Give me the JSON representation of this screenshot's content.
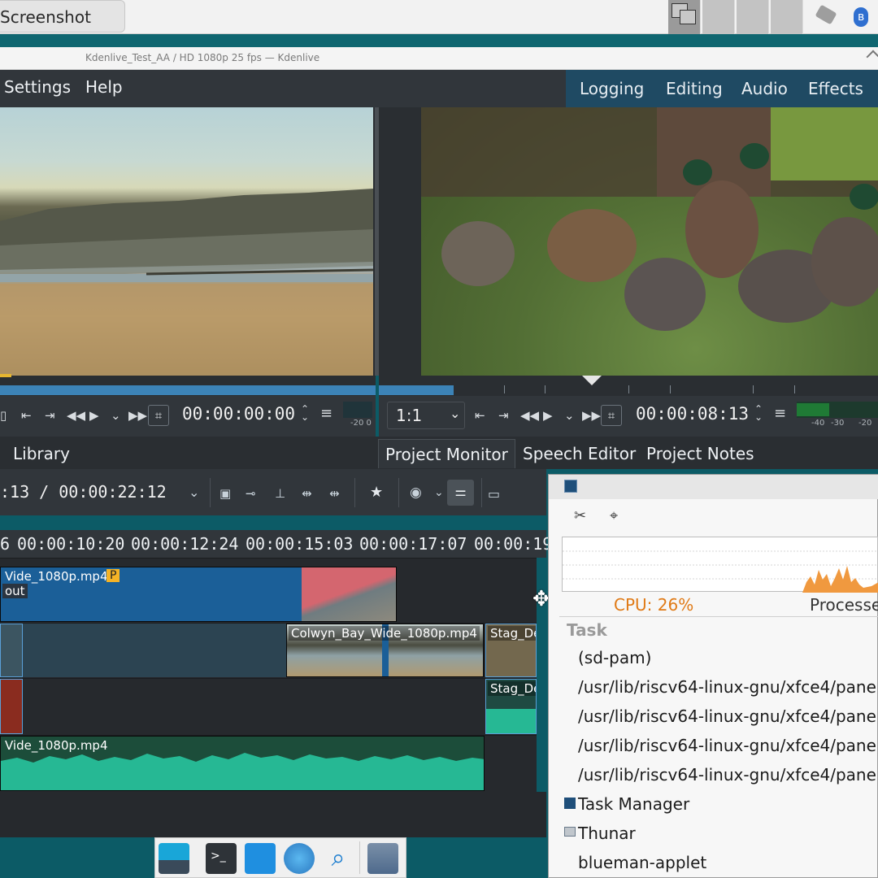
{
  "topbar": {
    "screenshot_tab": "Screenshot",
    "icons": [
      "workspace-switcher-icon",
      "usb-icon",
      "bluetooth-icon"
    ]
  },
  "window": {
    "title": "Kdenlive_Test_AA / HD 1080p 25 fps — Kdenlive"
  },
  "menubar": {
    "items": [
      "Settings",
      "Help"
    ],
    "layouts": [
      "Logging",
      "Editing",
      "Audio",
      "Effects"
    ]
  },
  "clip_monitor": {
    "timecode": "00:00:00:00",
    "meter_label": "-20 0"
  },
  "project_monitor": {
    "zoom": "1:1",
    "timecode": "00:00:08:13",
    "meter_labels": [
      "-40",
      "-30",
      "-20"
    ]
  },
  "dock_tabs": {
    "library": "Library",
    "project_monitor": "Project Monitor",
    "speech_editor": "Speech Editor",
    "project_notes": "Project Notes"
  },
  "timeline": {
    "position": ":13 / 00:00:22:12",
    "ruler": [
      "6",
      "00:00:10:20",
      "00:00:12:24",
      "00:00:15:03",
      "00:00:17:07",
      "00:00:19"
    ],
    "clips": {
      "v2_main": "Vide_1080p.mp4",
      "v2_badge": "P",
      "v2_sub": "out",
      "v1_mid": "Colwyn_Bay_Wide_1080p.mp4",
      "v1_right": "Stag_De",
      "a1_right": "Stag_De",
      "a2_main": "Vide_1080p.mp4"
    }
  },
  "task_manager": {
    "cpu": "CPU: 26%",
    "processes_label": "Processe",
    "column_task": "Task",
    "rows": [
      "(sd-pam)",
      "/usr/lib/riscv64-linux-gnu/xfce4/pane",
      "/usr/lib/riscv64-linux-gnu/xfce4/pane",
      "/usr/lib/riscv64-linux-gnu/xfce4/pane",
      "/usr/lib/riscv64-linux-gnu/xfce4/pane",
      "Task Manager",
      "Thunar",
      "blueman-applet"
    ]
  },
  "colors": {
    "accent": "#3c83b7",
    "audio_clip": "#26b894",
    "video_clip": "#1d5e93",
    "cpu_text": "#e07a16"
  }
}
